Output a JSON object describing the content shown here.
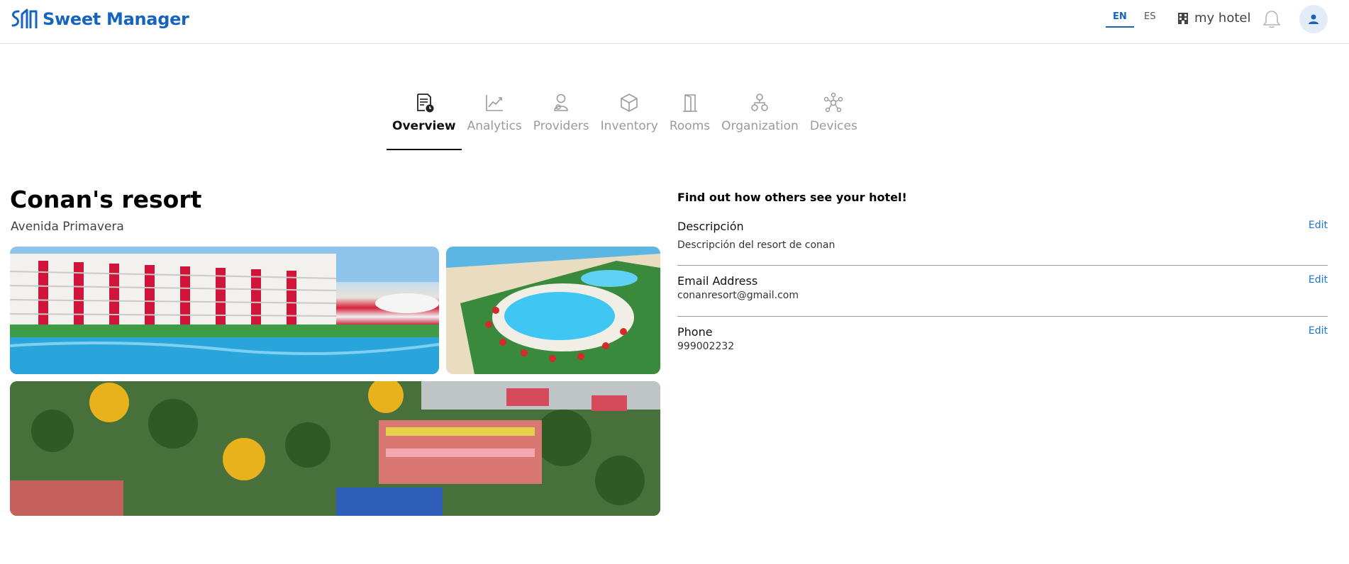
{
  "header": {
    "app_name": "Sweet Manager",
    "lang_en": "EN",
    "lang_es": "ES",
    "hotel_selector": "my hotel",
    "accent_color": "#1565c0"
  },
  "tabs": [
    {
      "label": "Overview",
      "icon": "report-clock-icon",
      "active": true
    },
    {
      "label": "Analytics",
      "icon": "chart-line-icon",
      "active": false
    },
    {
      "label": "Providers",
      "icon": "providers-icon",
      "active": false
    },
    {
      "label": "Inventory",
      "icon": "box-icon",
      "active": false
    },
    {
      "label": "Rooms",
      "icon": "door-icon",
      "active": false
    },
    {
      "label": "Organization",
      "icon": "org-chart-icon",
      "active": false
    },
    {
      "label": "Devices",
      "icon": "network-icon",
      "active": false
    }
  ],
  "hotel": {
    "name": "Conan's resort",
    "address": "Avenida Primavera"
  },
  "info": {
    "title": "Find out how others see your hotel!",
    "description_label": "Descripción",
    "description_value": "Descripción del resort de conan",
    "email_label": "Email Address",
    "email_value": "conanresort@gmail.com",
    "phone_label": "Phone",
    "phone_value": "999002232",
    "edit_label": "Edit"
  }
}
